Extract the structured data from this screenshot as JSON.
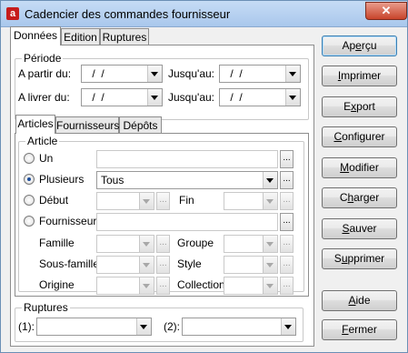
{
  "window": {
    "title": "Cadencier des commandes fournisseur",
    "close_glyph": "✕",
    "app_icon": "a"
  },
  "top_tabs": [
    "Données",
    "Edition",
    "Ruptures"
  ],
  "periode": {
    "title": "Période",
    "a_partir_label": "A partir du:",
    "a_partir_value": " /  /",
    "jusquau1_label": "Jusqu'au:",
    "jusquau1_value": " /  /",
    "a_livrer_label": "A livrer du:",
    "a_livrer_value": " /  /",
    "jusquau2_label": "Jusqu'au:",
    "jusquau2_value": " /  /"
  },
  "inner_tabs": [
    "Articles",
    "Fournisseurs",
    "Dépôts"
  ],
  "article": {
    "title": "Article",
    "un_label": "Un",
    "plusieurs_label": "Plusieurs",
    "plusieurs_value": "Tous",
    "debut_label": "Début",
    "fin_label": "Fin",
    "fournisseur_label": "Fournisseur",
    "famille_label": "Famille",
    "groupe_label": "Groupe",
    "sousfamille_label": "Sous-famille",
    "style_label": "Style",
    "origine_label": "Origine",
    "collection_label": "Collection",
    "selected": "plusieurs"
  },
  "ruptures": {
    "title": "Ruptures",
    "r1_label": "(1):",
    "r2_label": "(2):"
  },
  "buttons": {
    "apercu": {
      "pre": "Ap",
      "ul": "e",
      "post": "rçu"
    },
    "imprimer": {
      "pre": "",
      "ul": "I",
      "post": "mprimer"
    },
    "export": {
      "pre": "E",
      "ul": "x",
      "post": "port"
    },
    "configurer": {
      "pre": "",
      "ul": "C",
      "post": "onfigurer"
    },
    "modifier": {
      "pre": "",
      "ul": "M",
      "post": "odifier"
    },
    "charger": {
      "pre": "C",
      "ul": "h",
      "post": "arger"
    },
    "sauver": {
      "pre": "",
      "ul": "S",
      "post": "auver"
    },
    "supprimer": {
      "pre": "S",
      "ul": "u",
      "post": "pprimer"
    },
    "aide": {
      "pre": "",
      "ul": "A",
      "post": "ide"
    },
    "fermer": {
      "pre": "",
      "ul": "F",
      "post": "ermer"
    }
  },
  "ellipsis": "..."
}
